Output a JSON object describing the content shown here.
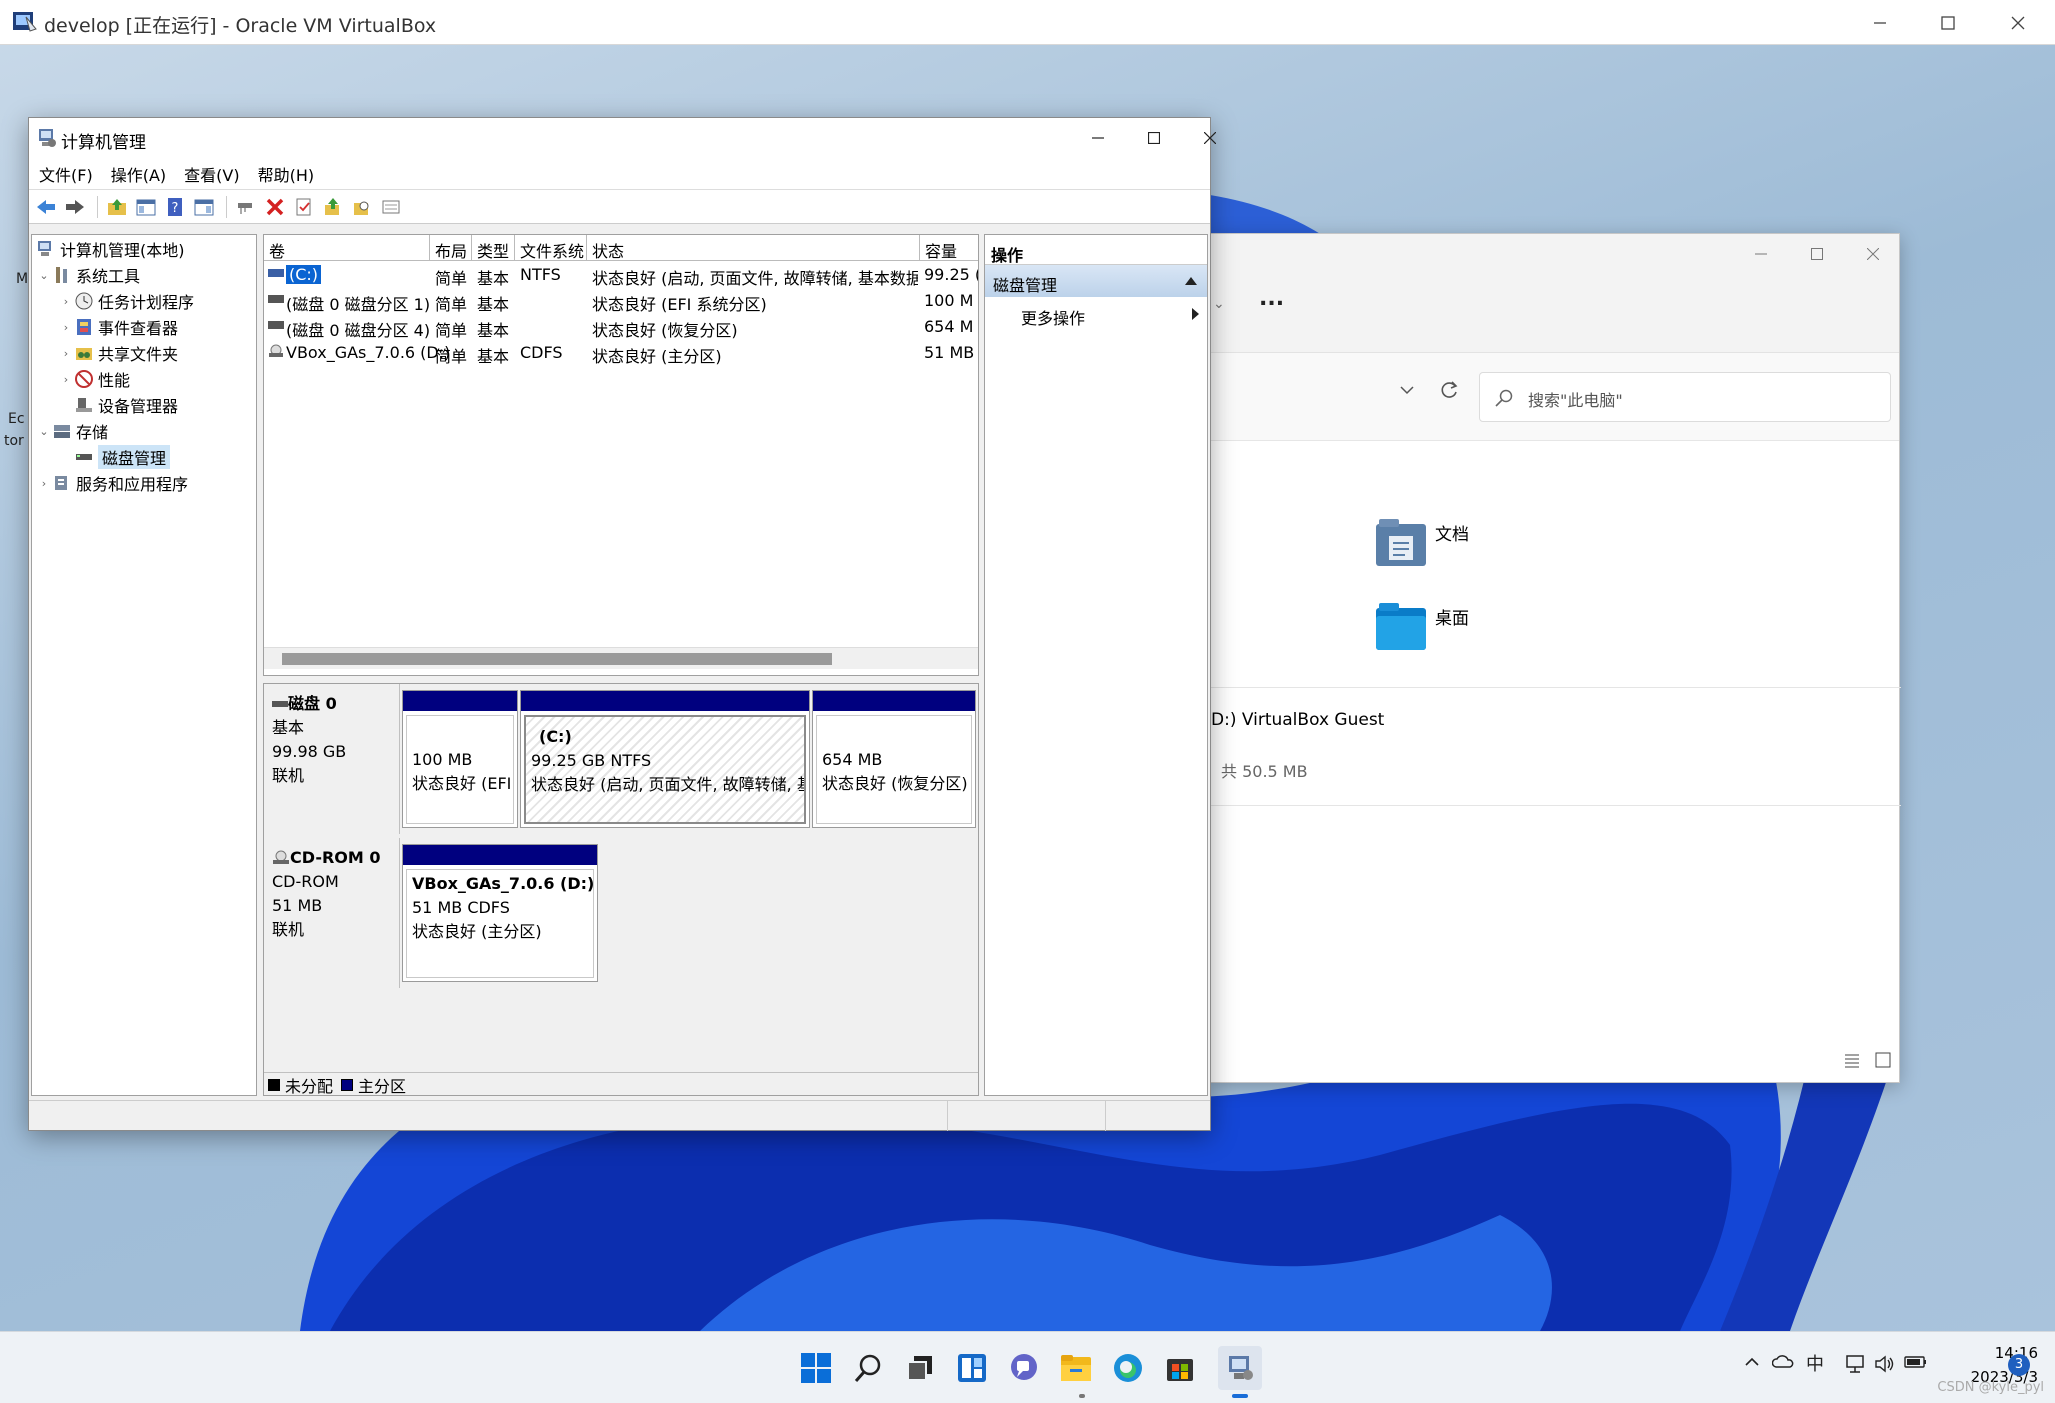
{
  "vbox": {
    "title": "develop [正在运行] - Oracle VM VirtualBox"
  },
  "desktop": {
    "fragments": [
      "M",
      "Ec",
      "tor"
    ]
  },
  "cm": {
    "title": "计算机管理",
    "menu": [
      "文件(F)",
      "操作(A)",
      "查看(V)",
      "帮助(H)"
    ],
    "tree": {
      "root": "计算机管理(本地)",
      "system_tools": "系统工具",
      "task_scheduler": "任务计划程序",
      "event_viewer": "事件查看器",
      "shared_folders": "共享文件夹",
      "performance": "性能",
      "device_manager": "设备管理器",
      "storage": "存储",
      "disk_management": "磁盘管理",
      "services_apps": "服务和应用程序"
    },
    "volume_columns": [
      "卷",
      "布局",
      "类型",
      "文件系统",
      "状态",
      "容量"
    ],
    "volumes": [
      {
        "name": "(C:)",
        "layout": "简单",
        "type": "基本",
        "fs": "NTFS",
        "status": "状态良好 (启动, 页面文件, 故障转储, 基本数据分区)",
        "capacity": "99.25 (",
        "selected": true
      },
      {
        "name": "(磁盘 0 磁盘分区 1)",
        "layout": "简单",
        "type": "基本",
        "fs": "",
        "status": "状态良好 (EFI 系统分区)",
        "capacity": "100 M",
        "selected": false
      },
      {
        "name": "(磁盘 0 磁盘分区 4)",
        "layout": "简单",
        "type": "基本",
        "fs": "",
        "status": "状态良好 (恢复分区)",
        "capacity": "654 M",
        "selected": false
      },
      {
        "name": "VBox_GAs_7.0.6 (D:)",
        "layout": "简单",
        "type": "基本",
        "fs": "CDFS",
        "status": "状态良好 (主分区)",
        "capacity": "51 MB",
        "selected": false
      }
    ],
    "disk0": {
      "name": "磁盘 0",
      "kind": "基本",
      "size": "99.98 GB",
      "state": "联机",
      "partitions": [
        {
          "title": "",
          "size": "100 MB",
          "status": "状态良好 (EFI 系"
        },
        {
          "title": "(C:)",
          "size": "99.25 GB NTFS",
          "status": "状态良好 (启动, 页面文件, 故障转储, 基本数"
        },
        {
          "title": "",
          "size": "654 MB",
          "status": "状态良好 (恢复分区)"
        }
      ]
    },
    "cdrom0": {
      "name": "CD-ROM 0",
      "kind": "CD-ROM",
      "size": "51 MB",
      "state": "联机",
      "partition": {
        "title": "VBox_GAs_7.0.6  (D:)",
        "size": "51 MB CDFS",
        "status": "状态良好 (主分区)"
      }
    },
    "legend": {
      "unallocated": "未分配",
      "primary": "主分区"
    },
    "actions": {
      "header": "操作",
      "section": "磁盘管理",
      "more": "更多操作"
    },
    "colors": {
      "primary_partition": "#00007f",
      "unallocated": "#000000"
    }
  },
  "explorer": {
    "more": "...",
    "search_placeholder": "搜索\"此电脑\"",
    "folders": [
      "文档",
      "桌面"
    ],
    "drive_name": "D:) VirtualBox Guest",
    "drive_size": "共 50.5 MB"
  },
  "taskbar": {
    "ime": "中",
    "time": "14:16",
    "date": "2023/3/3",
    "notifications": "3"
  },
  "watermark": "CSDN @kyle_pyl"
}
